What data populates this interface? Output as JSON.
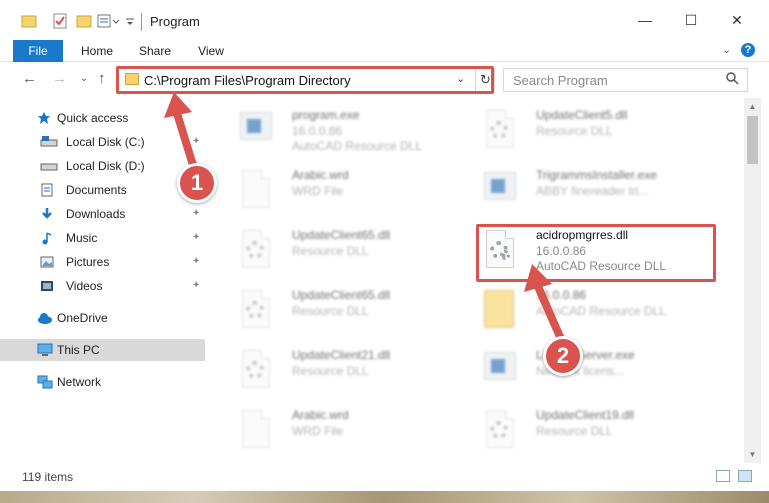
{
  "window": {
    "title": "Program",
    "minimize_glyph": "—",
    "maximize_glyph": "☐",
    "close_glyph": "✕"
  },
  "ribbon": {
    "tabs": [
      "File",
      "Home",
      "Share",
      "View"
    ],
    "expand_glyph": "⌄",
    "help_glyph": "?"
  },
  "address": {
    "path": "C:\\Program Files\\Program Directory",
    "dropdown_glyph": "⌄",
    "refresh_glyph": "↻",
    "back_glyph": "←",
    "forward_glyph": "→",
    "history_glyph": "⌄",
    "up_glyph": "↑"
  },
  "search": {
    "placeholder": "Search Program",
    "icon": "search-icon"
  },
  "nav": {
    "items": [
      {
        "label": "Quick access",
        "icon": "star-icon",
        "pinned": false
      },
      {
        "label": "Local Disk (C:)",
        "icon": "drive-icon",
        "pinned": true
      },
      {
        "label": "Local Disk (D:)",
        "icon": "drive-icon",
        "pinned": true
      },
      {
        "label": "Documents",
        "icon": "documents-icon",
        "pinned": true
      },
      {
        "label": "Downloads",
        "icon": "download-icon",
        "pinned": true
      },
      {
        "label": "Music",
        "icon": "music-icon",
        "pinned": true
      },
      {
        "label": "Pictures",
        "icon": "pictures-icon",
        "pinned": true
      },
      {
        "label": "Videos",
        "icon": "videos-icon",
        "pinned": true
      },
      {
        "label": "OneDrive",
        "icon": "cloud-icon",
        "pinned": false
      },
      {
        "label": "This PC",
        "icon": "computer-icon",
        "pinned": false
      },
      {
        "label": "Network",
        "icon": "network-icon",
        "pinned": false
      }
    ],
    "pin_glyph": "📌"
  },
  "files": [
    {
      "name": "program.exe",
      "line1": "16.0.0.86",
      "line2": "AutoCAD Resource DLL",
      "icon": "exe-icon"
    },
    {
      "name": "UpdateClient5.dll",
      "line1": "Resource DLL",
      "line2": "",
      "icon": "dll-icon"
    },
    {
      "name": "Arabic.wrd",
      "line1": "WRD File",
      "line2": "",
      "icon": "file-icon"
    },
    {
      "name": "TrigrammsInstaller.exe",
      "line1": "ABBY finereader tri...",
      "line2": "",
      "icon": "exe-icon"
    },
    {
      "name": "UpdateClient65.dll",
      "line1": "Resource DLL",
      "line2": "",
      "icon": "dll-icon"
    },
    {
      "name": "acidropmgrres.dll",
      "line1": "16.0.0.86",
      "line2": "AutoCAD Resource DLL",
      "icon": "dll-icon"
    },
    {
      "name": "UpdateClient65.dll",
      "line1": "Resource DLL",
      "line2": "",
      "icon": "dll-icon"
    },
    {
      "name": "16.0.0.86",
      "line1": "AutoCAD Resource DLL",
      "line2": "",
      "icon": "zip-icon"
    },
    {
      "name": "UpdateClient21.dll",
      "line1": "Resource DLL",
      "line2": "",
      "icon": "dll-icon"
    },
    {
      "name": "LicenseServer.exe",
      "line1": "Network licens...",
      "line2": "",
      "icon": "exe-icon"
    },
    {
      "name": "Arabic.wrd",
      "line1": "WRD File",
      "line2": "",
      "icon": "file-icon"
    },
    {
      "name": "UpdateClient19.dll",
      "line1": "Resource DLL",
      "line2": "",
      "icon": "dll-icon"
    }
  ],
  "status": {
    "item_count": "119 items"
  },
  "annotations": {
    "step1": "1",
    "step2": "2",
    "color": "#d9534f"
  }
}
